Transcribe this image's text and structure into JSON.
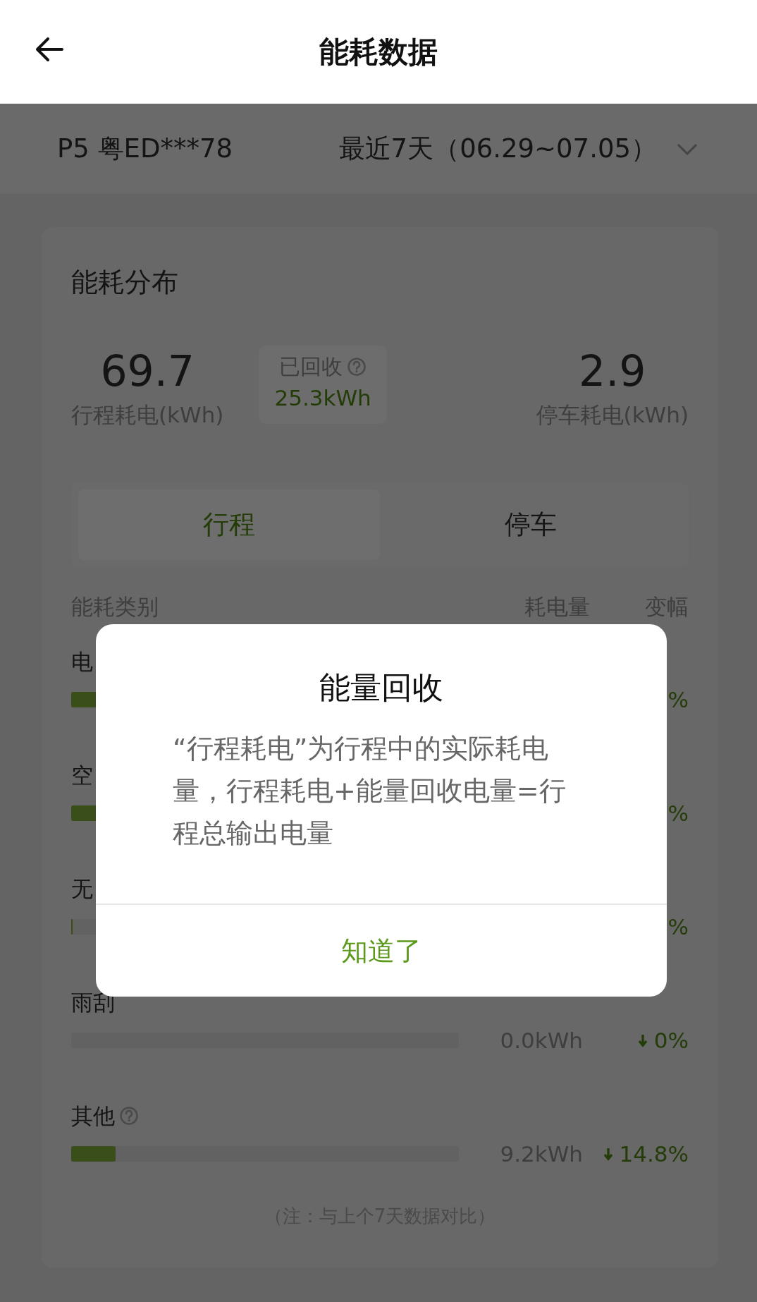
{
  "header": {
    "title": "能耗数据"
  },
  "vehicle_bar": {
    "vehicle": "P5 粤ED***78",
    "period": "最近7天（06.29~07.05）"
  },
  "card": {
    "title": "能耗分布",
    "trip": {
      "value": "69.7",
      "label": "行程耗电(kWh)"
    },
    "recovered": {
      "label": "已回收",
      "value": "25.3kWh"
    },
    "parking": {
      "value": "2.9",
      "label": "停车耗电(kWh)"
    },
    "tabs": [
      {
        "label": "行程",
        "selected": true
      },
      {
        "label": "停车",
        "selected": false
      }
    ],
    "columns": [
      "能耗类别",
      "耗电量",
      "变幅"
    ],
    "rows": [
      {
        "label": "电",
        "help": false,
        "level": 0.55,
        "change": "%"
      },
      {
        "label": "空",
        "help": false,
        "level": 0.35,
        "change": "%"
      },
      {
        "label": "无",
        "help": false,
        "level": 0.004,
        "change": "%"
      },
      {
        "label": "雨刮",
        "help": false,
        "level": 0,
        "amount": "0.0kWh",
        "decrease": true,
        "change": "0%"
      },
      {
        "label": "其他",
        "help": true,
        "level": 0.115,
        "amount": "9.2kWh",
        "decrease": true,
        "change": "14.8%"
      }
    ],
    "note": "（注：与上个7天数据对比）"
  },
  "dialog": {
    "title": "能量回收",
    "body": "“行程耗电”为行程中的实际耗电量，行程耗电+能量回收电量=行程总输出电量",
    "button": "知道了"
  }
}
